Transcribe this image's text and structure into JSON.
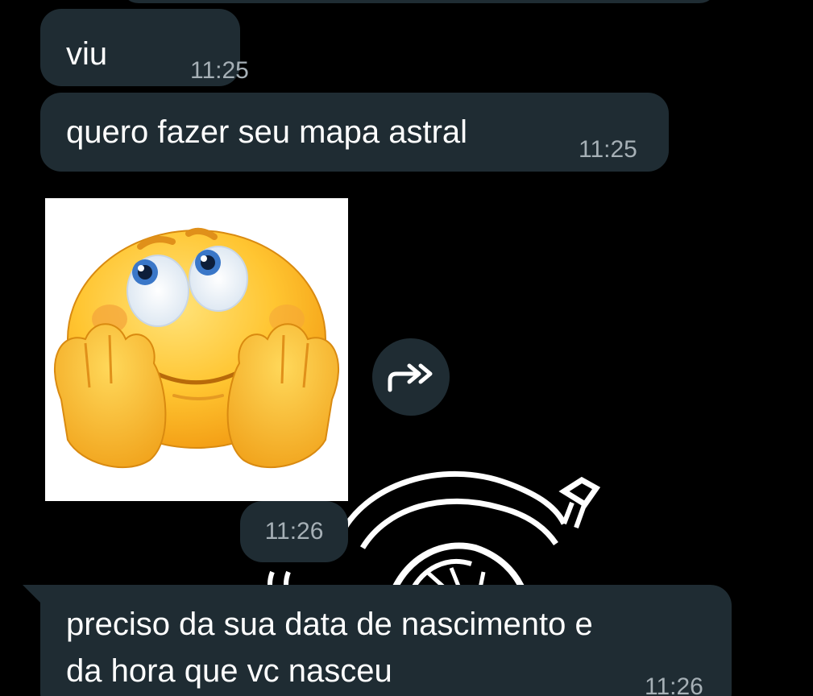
{
  "messages": [
    {
      "text": "viu",
      "time": "11:25"
    },
    {
      "text": "quero fazer seu mapa astral",
      "time": "11:25"
    },
    {
      "sticker": "smiley-dreaming-emoji",
      "time": "11:26"
    },
    {
      "lines": [
        "preciso da sua data de nascimento e",
        "da hora que vc nasceu"
      ],
      "time": "11:26"
    }
  ],
  "icons": {
    "forward": "forward-double-arrow-icon",
    "sticker": "smiley-dreaming-emoji"
  },
  "colors": {
    "background": "#000000",
    "bubble": "#1f2c33",
    "time": "#a6b0b6",
    "text": "#ffffff"
  }
}
